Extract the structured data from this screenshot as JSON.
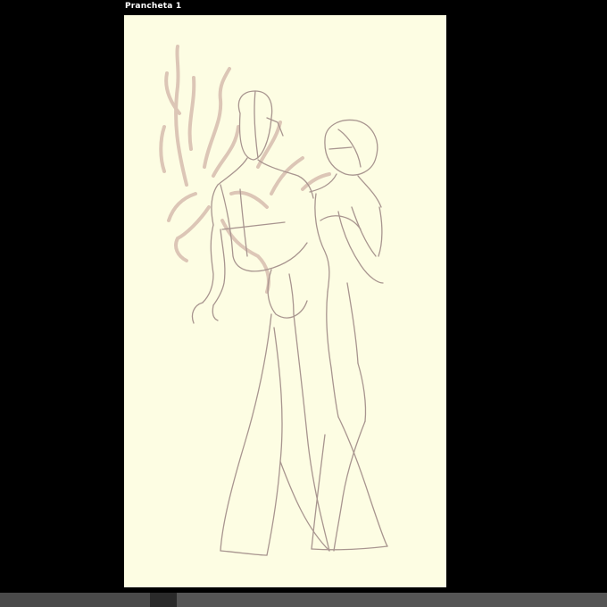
{
  "artboard": {
    "title": "Prancheta 1",
    "background_color": "#fdfde3",
    "sketch_stroke_color": "#a89a96",
    "tree_stroke_color": "#c8aaa0"
  },
  "workspace": {
    "background_color": "#000000"
  }
}
